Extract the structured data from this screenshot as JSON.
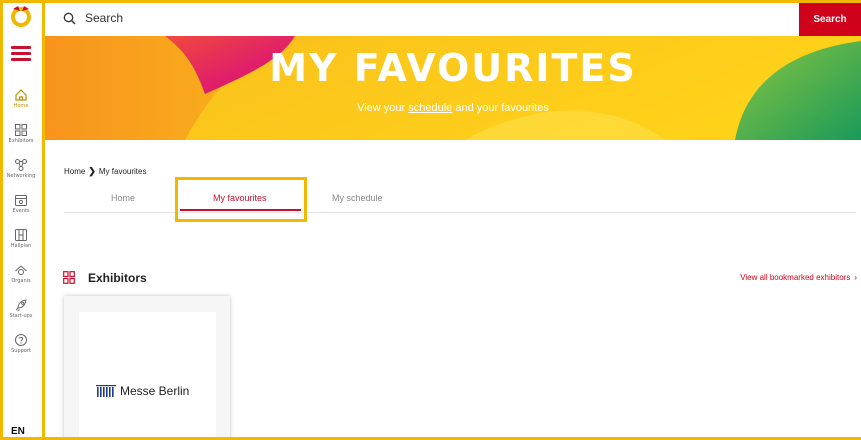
{
  "colors": {
    "accent": "#c8102e",
    "highlight": "#f2b800",
    "search_button": "#d0021b"
  },
  "sidebar": {
    "items": [
      {
        "label": "Home",
        "icon": "home-icon",
        "active": true
      },
      {
        "label": "Exhibitors",
        "icon": "exhibitors-icon"
      },
      {
        "label": "Networking",
        "icon": "networking-icon"
      },
      {
        "label": "Events",
        "icon": "events-icon"
      },
      {
        "label": "Hallplan",
        "icon": "hallplan-icon"
      },
      {
        "label": "Organis",
        "icon": "organis-icon"
      },
      {
        "label": "Start-ups",
        "icon": "rocket-icon"
      },
      {
        "label": "Support",
        "icon": "support-icon"
      }
    ],
    "language": "EN"
  },
  "topbar": {
    "search_placeholder": "Search",
    "search_button": "Search"
  },
  "banner": {
    "title": "MY FAVOURITES",
    "subtitle_before": "View your",
    "subtitle_link": "schedule",
    "subtitle_after": "and your favourites"
  },
  "breadcrumb": {
    "home": "Home",
    "current": "My favourites"
  },
  "tabs": [
    {
      "label": "Home"
    },
    {
      "label": "My favourites",
      "active": true
    },
    {
      "label": "My schedule"
    }
  ],
  "exhibitors": {
    "title": "Exhibitors",
    "view_all": "View all bookmarked exhibitors",
    "cards": [
      {
        "name": "Messe Berlin"
      }
    ]
  }
}
